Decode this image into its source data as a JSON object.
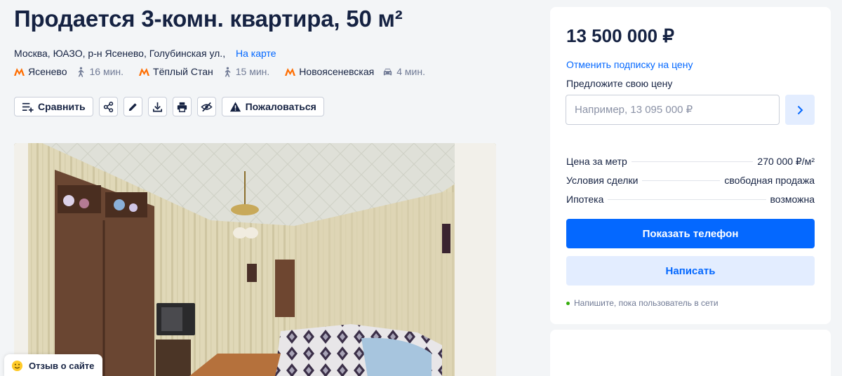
{
  "listing": {
    "title": "Продается 3-комн. квартира, 50 м²",
    "address": "Москва, ЮАЗО, р-н Ясенево, Голубинская ул.,",
    "map_link": "На карте",
    "metro": [
      {
        "station": "Ясенево",
        "time": "16 мин.",
        "mode": "walk-icon"
      },
      {
        "station": "Тёплый Стан",
        "time": "15 мин.",
        "mode": "walk-icon"
      },
      {
        "station": "Новоясеневская",
        "time": "4 мин.",
        "mode": "car-icon"
      }
    ],
    "metro_color": "#ff6d00"
  },
  "toolbar": {
    "compare": "Сравнить",
    "report": "Пожаловаться"
  },
  "feedback": {
    "label": "Отзыв о сайте"
  },
  "sidebar": {
    "price": "13 500 000 ₽",
    "unsubscribe": "Отменить подписку на цену",
    "offer_label": "Предложите свою цену",
    "offer_placeholder": "Например, 13 095 000 ₽",
    "facts": [
      {
        "label": "Цена за метр",
        "value": "270 000 ₽/м²"
      },
      {
        "label": "Условия сделки",
        "value": "свободная продажа"
      },
      {
        "label": "Ипотека",
        "value": "возможна"
      }
    ],
    "show_phone": "Показать телефон",
    "write": "Написать",
    "online_hint": "Напишите, пока пользователь в сети"
  },
  "colors": {
    "accent": "#0468ff",
    "accent_light": "#e3edff",
    "online": "#34ac0a",
    "text": "#152242"
  }
}
